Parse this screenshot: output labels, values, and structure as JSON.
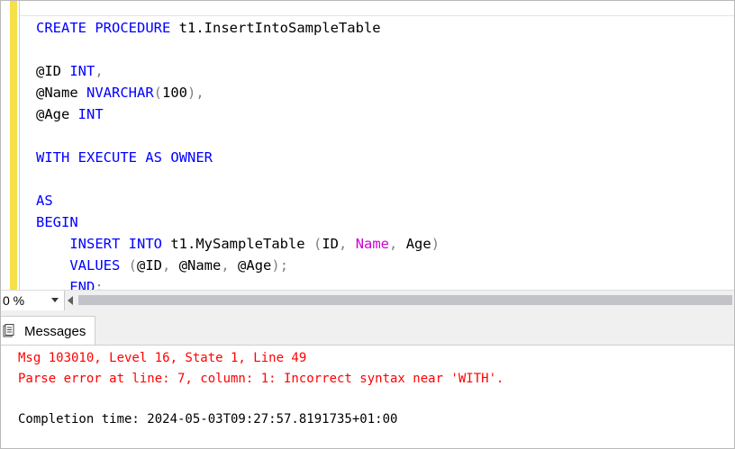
{
  "editor": {
    "lines": [
      [
        {
          "t": "CREATE",
          "c": "kw"
        },
        {
          "t": " "
        },
        {
          "t": "PROCEDURE",
          "c": "kw"
        },
        {
          "t": " t1.InsertIntoSampleTable"
        }
      ],
      [],
      [
        {
          "t": "@ID "
        },
        {
          "t": "INT",
          "c": "kw"
        },
        {
          "t": ",",
          "c": "gr"
        }
      ],
      [
        {
          "t": "@Name "
        },
        {
          "t": "NVARCHAR",
          "c": "kw"
        },
        {
          "t": "(",
          "c": "gr"
        },
        {
          "t": "100"
        },
        {
          "t": "),",
          "c": "gr"
        }
      ],
      [
        {
          "t": "@Age "
        },
        {
          "t": "INT",
          "c": "kw"
        }
      ],
      [],
      [
        {
          "t": "WITH",
          "c": "kw"
        },
        {
          "t": " "
        },
        {
          "t": "EXECUTE",
          "c": "kw"
        },
        {
          "t": " "
        },
        {
          "t": "AS",
          "c": "kw"
        },
        {
          "t": " "
        },
        {
          "t": "OWNER",
          "c": "kw"
        }
      ],
      [],
      [
        {
          "t": "AS",
          "c": "kw"
        }
      ],
      [
        {
          "t": "BEGIN",
          "c": "kw"
        }
      ],
      [
        {
          "t": "    "
        },
        {
          "t": "INSERT",
          "c": "kw"
        },
        {
          "t": " "
        },
        {
          "t": "INTO",
          "c": "kw"
        },
        {
          "t": " t1.MySampleTable "
        },
        {
          "t": "(",
          "c": "gr"
        },
        {
          "t": "ID"
        },
        {
          "t": ",",
          "c": "gr"
        },
        {
          "t": " "
        },
        {
          "t": "Name",
          "c": "pk"
        },
        {
          "t": ",",
          "c": "gr"
        },
        {
          "t": " Age"
        },
        {
          "t": ")",
          "c": "gr"
        }
      ],
      [
        {
          "t": "    "
        },
        {
          "t": "VALUES",
          "c": "kw"
        },
        {
          "t": " "
        },
        {
          "t": "(",
          "c": "gr"
        },
        {
          "t": "@ID"
        },
        {
          "t": ",",
          "c": "gr"
        },
        {
          "t": " @Name"
        },
        {
          "t": ",",
          "c": "gr"
        },
        {
          "t": " @Age"
        },
        {
          "t": ");",
          "c": "gr"
        }
      ],
      [
        {
          "t": "    "
        },
        {
          "t": "END",
          "c": "kw"
        },
        {
          "t": ";",
          "c": "gr"
        }
      ]
    ]
  },
  "zoom": {
    "value": "0 %"
  },
  "results": {
    "tab_label": "Messages",
    "error_line1": "Msg 103010, Level 16, State 1, Line 49",
    "error_line2": "Parse error at line: 7, column: 1: Incorrect syntax near 'WITH'.",
    "completion": "Completion time: 2024-05-03T09:27:57.8191735+01:00"
  },
  "colors": {
    "keyword": "#0000ff",
    "punctuation": "#808080",
    "function": "#d100d1",
    "error": "#ff0000",
    "gutter": "#f6e04a"
  },
  "icons": {
    "messages_tab": "messages-icon",
    "zoom_dropdown": "chevron-down-icon"
  }
}
